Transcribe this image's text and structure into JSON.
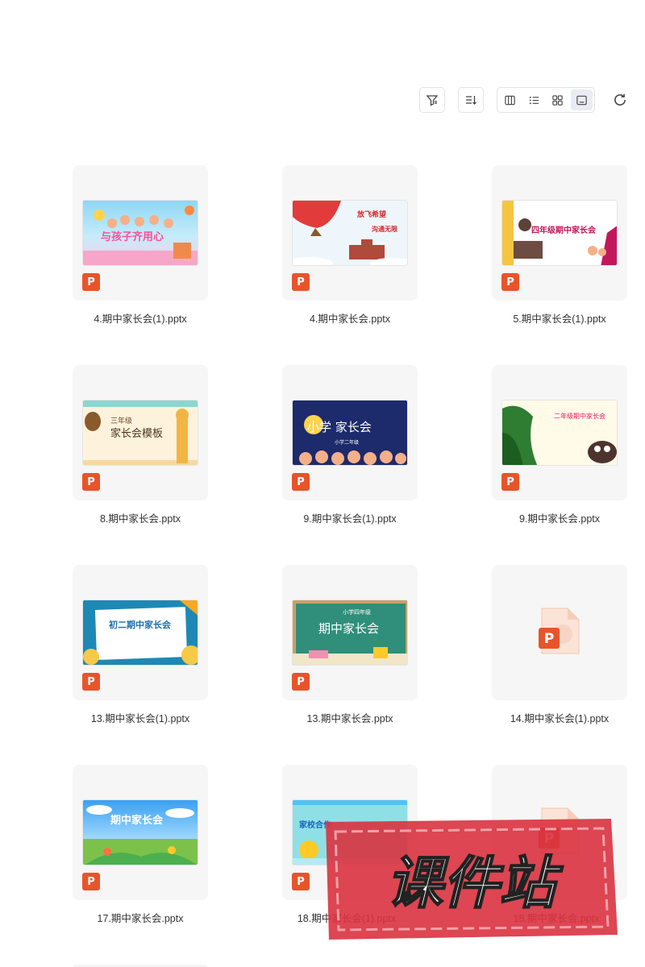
{
  "toolbar": {
    "filter_icon": "filter-icon",
    "sort_icon": "sort-icon",
    "views": [
      "column-view-icon",
      "list-view-icon",
      "grid-view-icon",
      "preview-view-icon"
    ],
    "active_view": "preview-view-icon",
    "refresh_icon": "refresh-icon"
  },
  "files": [
    {
      "name": "4.期中家长会(1).pptx",
      "thumb_title": "与孩子齐用心",
      "badge": "P"
    },
    {
      "name": "4.期中家长会.pptx",
      "thumb_title": "放飞希望",
      "thumb_sub": "沟通无限",
      "badge": "P"
    },
    {
      "name": "5.期中家长会(1).pptx",
      "thumb_title": "四年级期中家长会",
      "badge": "P"
    },
    {
      "name": "8.期中家长会.pptx",
      "thumb_title": "三年级",
      "thumb_sub": "家长会模板",
      "badge": "P"
    },
    {
      "name": "9.期中家长会(1).pptx",
      "thumb_title": "小学 家长会",
      "thumb_sub": "小学二年级",
      "badge": "P"
    },
    {
      "name": "9.期中家长会.pptx",
      "thumb_title": "二年级期中家长会",
      "badge": "P"
    },
    {
      "name": "13.期中家长会(1).pptx",
      "thumb_title": "初二期中家长会",
      "badge": "P"
    },
    {
      "name": "13.期中家长会.pptx",
      "thumb_title": "期中家长会",
      "thumb_sub": "小学四年级",
      "badge": "P"
    },
    {
      "name": "14.期中家长会(1).pptx",
      "badge": "P"
    },
    {
      "name": "17.期中家长会.pptx",
      "thumb_title": "期中家长会",
      "badge": "P"
    },
    {
      "name": "18.期中家长会(1).pptx",
      "thumb_title": "家校合作",
      "badge": "P"
    },
    {
      "name": "18.期中家长会.pptx",
      "badge": "P"
    }
  ],
  "watermark": {
    "text": "课件站"
  },
  "colors": {
    "ppt_badge": "#e8542a",
    "card_bg": "#f6f6f6",
    "watermark": "#d9323f"
  }
}
